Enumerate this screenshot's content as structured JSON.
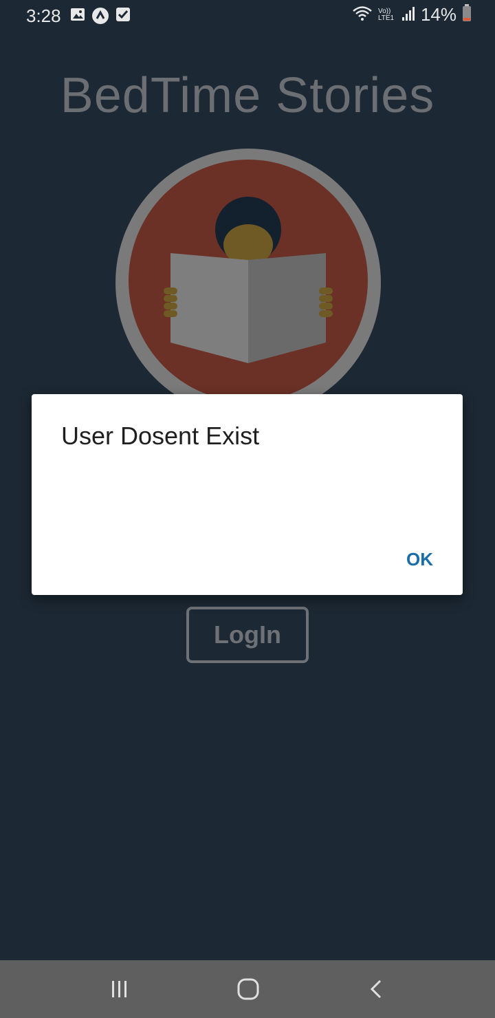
{
  "status_bar": {
    "time": "3:28",
    "battery_percent": "14%",
    "network_label": "Vo)) LTE1",
    "icons": [
      "image-icon",
      "app-a-icon",
      "check-icon",
      "wifi-icon",
      "signal-icon",
      "battery-icon"
    ]
  },
  "app": {
    "title": "BedTime Stories",
    "login_label": "LogIn"
  },
  "dialog": {
    "message": "User Dosent Exist",
    "ok_label": "OK"
  },
  "nav_bar": {
    "items": [
      "recents-icon",
      "home-icon",
      "back-icon"
    ]
  },
  "colors": {
    "background": "#1c2833",
    "dialog_button": "#1a6ea8",
    "logo_ring": "#7a7a7a",
    "logo_circle": "#6b3126",
    "nav_bar": "#5f5f5f"
  }
}
